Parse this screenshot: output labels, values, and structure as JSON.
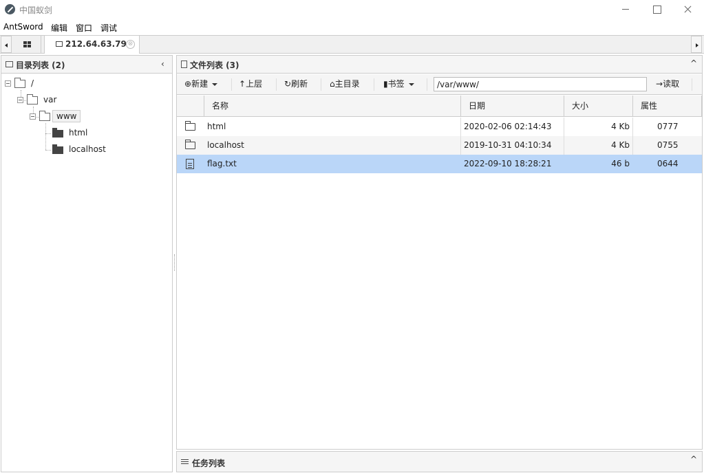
{
  "window": {
    "title": "中国蚁剑"
  },
  "menu": [
    "AntSword",
    "编辑",
    "窗口",
    "调试"
  ],
  "tab": {
    "label": "212.64.63.79",
    "close": "⊗"
  },
  "dir_panel": {
    "title": "目录列表 (2)",
    "collapse": "‹",
    "tree": [
      {
        "label": "/",
        "level": 0
      },
      {
        "label": "var",
        "level": 1
      },
      {
        "label": "www",
        "level": 2,
        "selected": true
      },
      {
        "label": "html",
        "level": 3
      },
      {
        "label": "localhost",
        "level": 3
      }
    ]
  },
  "file_panel": {
    "title": "文件列表 (3)",
    "expand": "^",
    "toolbar": {
      "new": "新建",
      "up": "上层",
      "refresh": "刷新",
      "home": "主目录",
      "bookmark": "书签",
      "read": "读取"
    },
    "path": "/var/www/",
    "columns": [
      "名称",
      "日期",
      "大小",
      "属性"
    ],
    "rows": [
      {
        "name": "html",
        "type": "folder",
        "date": "2020-02-06 02:14:43",
        "size": "4 Kb",
        "perm": "0777"
      },
      {
        "name": "localhost",
        "type": "folder",
        "date": "2019-10-31 04:10:34",
        "size": "4 Kb",
        "perm": "0755"
      },
      {
        "name": "flag.txt",
        "type": "file",
        "date": "2022-09-10 18:28:21",
        "size": "46 b",
        "perm": "0644",
        "selected": true
      }
    ]
  },
  "task_panel": {
    "title": "任务列表",
    "expand": "^"
  },
  "colors": {
    "selected_row": "#bad6f8",
    "panel_bg": "#f5f5f5",
    "border": "#cccccc"
  }
}
